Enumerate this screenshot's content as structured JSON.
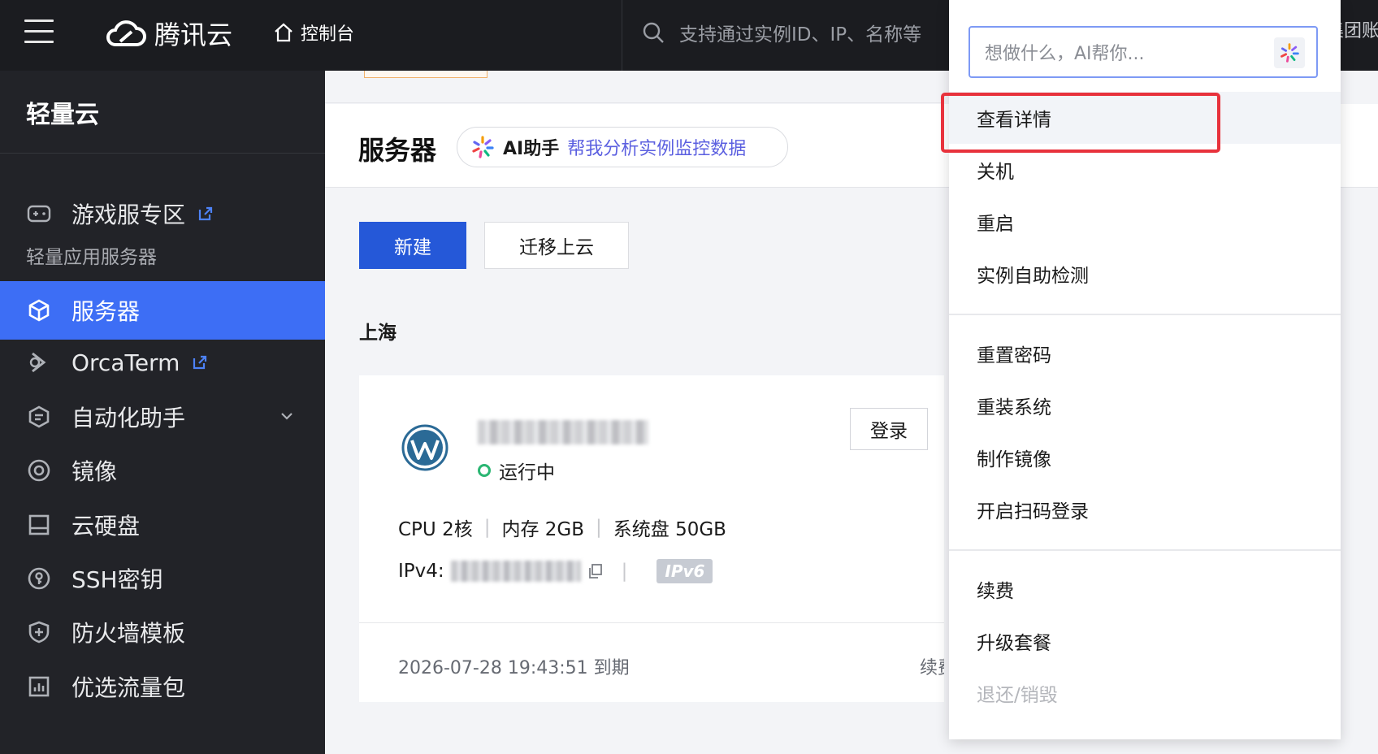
{
  "topbar": {
    "brand": "腾讯云",
    "console_label": "控制台",
    "search_placeholder": "支持通过实例ID、IP、名称等",
    "right_text": "集团账号"
  },
  "sidebar": {
    "title": "轻量云",
    "items": [
      {
        "label": "游戏服专区",
        "icon": "gamepad-icon",
        "external": true
      },
      {
        "label": "服务器",
        "icon": "cube-icon",
        "active": true
      },
      {
        "label": "OrcaTerm",
        "icon": "terminal-icon",
        "external": true
      },
      {
        "label": "自动化助手",
        "icon": "automation-icon",
        "expandable": true
      },
      {
        "label": "镜像",
        "icon": "disc-icon"
      },
      {
        "label": "云硬盘",
        "icon": "disk-icon"
      },
      {
        "label": "SSH密钥",
        "icon": "key-icon"
      },
      {
        "label": "防火墙模板",
        "icon": "shield-icon"
      },
      {
        "label": "优选流量包",
        "icon": "chart-icon"
      }
    ],
    "group_label": "轻量应用服务器"
  },
  "page": {
    "title": "服务器",
    "ai_label": "AI助手",
    "ai_prompt": "帮我分析实例监控数据",
    "create_button": "新建",
    "migrate_button": "迁移上云",
    "region": "上海"
  },
  "instance": {
    "status": "运行中",
    "login_button": "登录",
    "cpu": "CPU 2核",
    "memory": "内存 2GB",
    "system_disk": "系统盘 50GB",
    "ipv4_label": "IPv4:",
    "ipv6_badge": "IPv6",
    "expiry": "2026-07-28 19:43:51 到期",
    "renew_label": "续费",
    "colors": {
      "status": "#2bb673"
    }
  },
  "dropdown": {
    "ai_placeholder": "想做什么，AI帮你...",
    "groups": [
      [
        "查看详情",
        "关机",
        "重启",
        "实例自助检测"
      ],
      [
        "重置密码",
        "重装系统",
        "制作镜像",
        "开启扫码登录"
      ],
      [
        "续费",
        "升级套餐",
        "退还/销毁"
      ]
    ]
  },
  "colors": {
    "accent": "#2558d8",
    "sidebar_active": "#3d6ef5",
    "highlight": "#e8323c"
  }
}
